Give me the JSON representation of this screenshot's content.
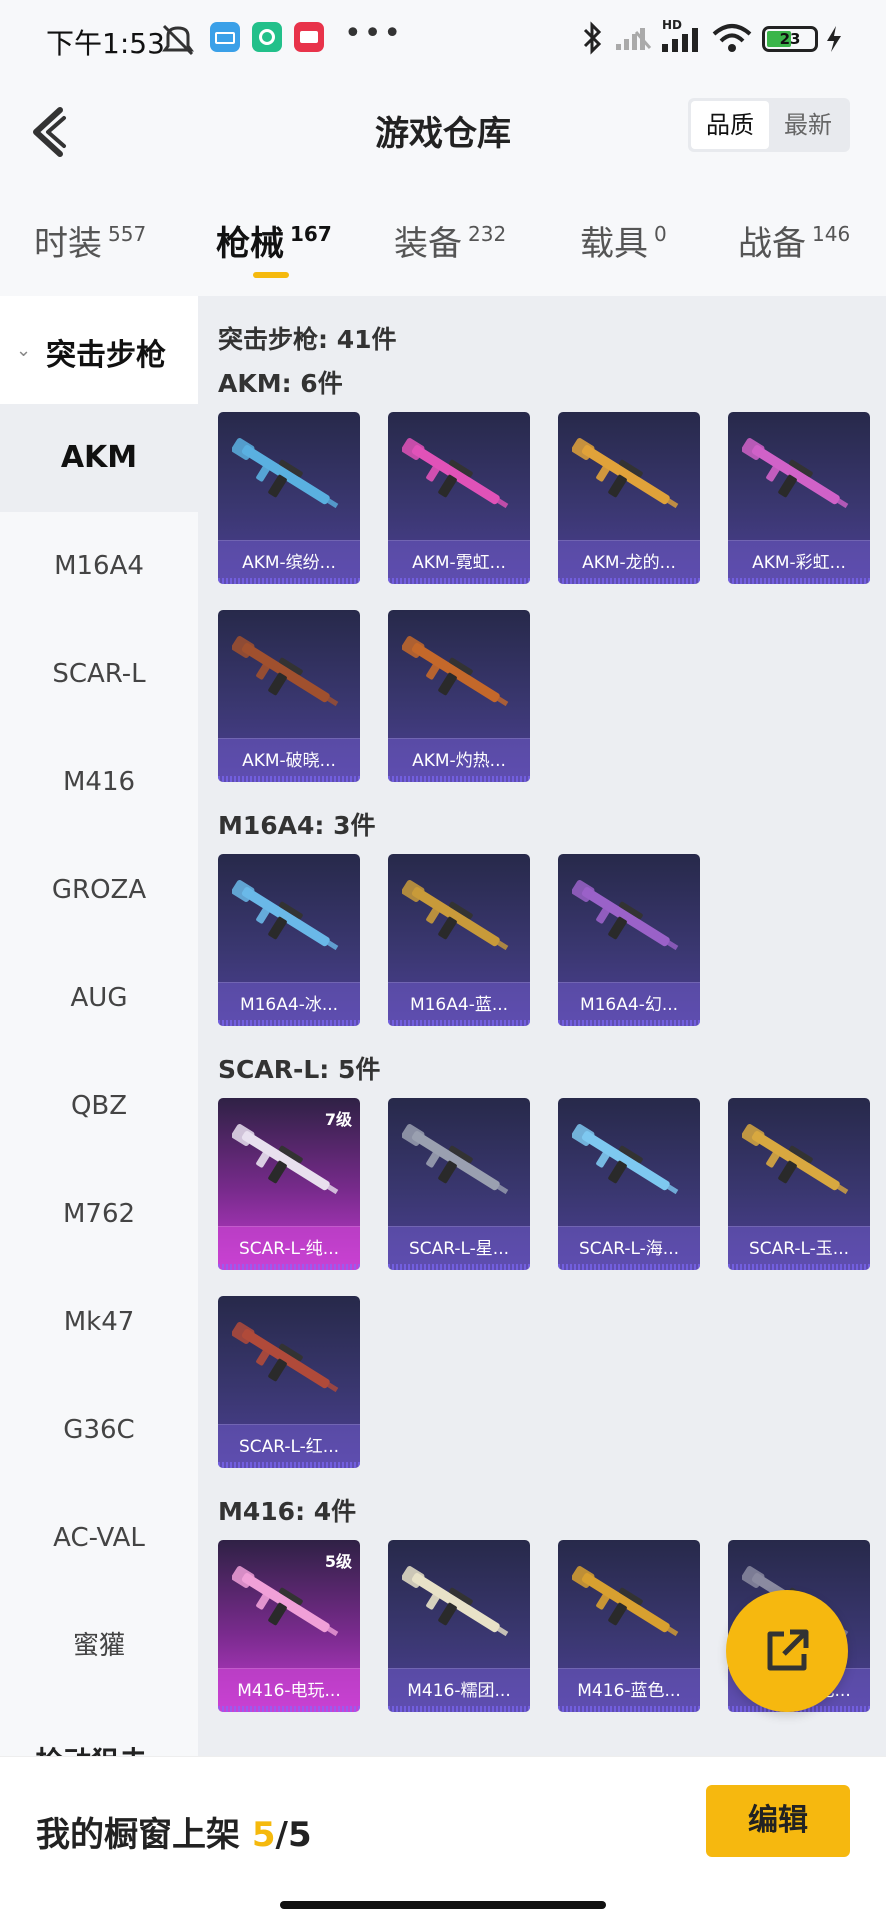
{
  "status_bar": {
    "time": "下午1:53",
    "battery": "23",
    "more": "•••",
    "network": "HD"
  },
  "header": {
    "title": "游戏仓库",
    "sort_options": [
      "品质",
      "最新"
    ]
  },
  "tabs": [
    {
      "label": "时装",
      "count": "557"
    },
    {
      "label": "枪械",
      "count": "167"
    },
    {
      "label": "装备",
      "count": "232"
    },
    {
      "label": "载具",
      "count": "0"
    },
    {
      "label": "战备",
      "count": "146"
    }
  ],
  "sidebar": {
    "group": "突击步枪",
    "items": [
      "AKM",
      "M16A4",
      "SCAR-L",
      "M416",
      "GROZA",
      "AUG",
      "QBZ",
      "M762",
      "Mk47",
      "G36C",
      "AC-VAL",
      "蜜獾"
    ],
    "next_group": "栓动狙击"
  },
  "content": {
    "total": "突击步枪: 41件",
    "sections": [
      {
        "title": "AKM: 6件",
        "cards": [
          {
            "name": "AKM-缤纷...",
            "level": "",
            "gun_color": "#5ab0e0"
          },
          {
            "name": "AKM-霓虹...",
            "level": "",
            "gun_color": "#e052b8"
          },
          {
            "name": "AKM-龙的...",
            "level": "",
            "gun_color": "#e0a23a"
          },
          {
            "name": "AKM-彩虹...",
            "level": "",
            "gun_color": "#d062c8"
          },
          {
            "name": "AKM-破晓...",
            "level": "",
            "gun_color": "#a0502e"
          },
          {
            "name": "AKM-灼热...",
            "level": "",
            "gun_color": "#c4682a"
          }
        ]
      },
      {
        "title": "M16A4: 3件",
        "cards": [
          {
            "name": "M16A4-冰...",
            "level": "",
            "gun_color": "#6ab8e8"
          },
          {
            "name": "M16A4-蓝...",
            "level": "",
            "gun_color": "#c89a3a"
          },
          {
            "name": "M16A4-幻...",
            "level": "",
            "gun_color": "#9a62c8"
          }
        ]
      },
      {
        "title": "SCAR-L: 5件",
        "cards": [
          {
            "name": "SCAR-L-纯...",
            "level": "7级",
            "gun_color": "#e8e0ee"
          },
          {
            "name": "SCAR-L-星...",
            "level": "",
            "gun_color": "#9aa0b0"
          },
          {
            "name": "SCAR-L-海...",
            "level": "",
            "gun_color": "#7ec8f0"
          },
          {
            "name": "SCAR-L-玉...",
            "level": "",
            "gun_color": "#d8a840"
          },
          {
            "name": "SCAR-L-红...",
            "level": "",
            "gun_color": "#b04a3a"
          }
        ]
      },
      {
        "title": "M416: 4件",
        "cards": [
          {
            "name": "M416-电玩...",
            "level": "5级",
            "gun_color": "#f0a0d8"
          },
          {
            "name": "M416-糯团...",
            "level": "",
            "gun_color": "#e8e2c8"
          },
          {
            "name": "M416-蓝色...",
            "level": "",
            "gun_color": "#d8a030"
          },
          {
            "name": "M416-红色...",
            "level": "",
            "gun_color": "#8a8aa0"
          }
        ]
      }
    ]
  },
  "bottom": {
    "shelf_label": "我的橱窗上架",
    "shelf_current": "5",
    "shelf_sep": "/",
    "shelf_total": "5",
    "edit": "编辑"
  }
}
